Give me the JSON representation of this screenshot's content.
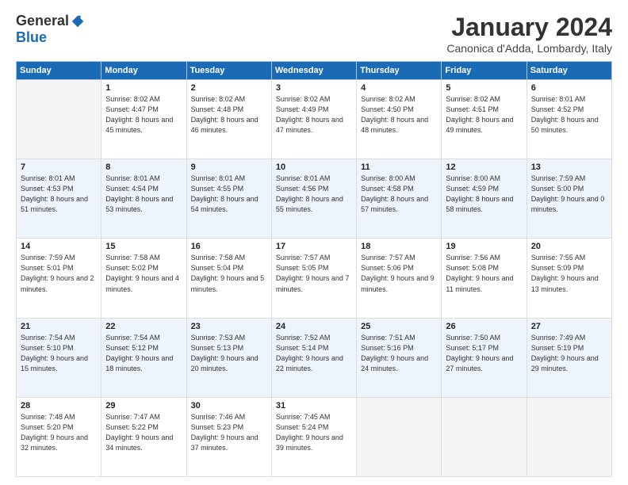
{
  "header": {
    "logo_general": "General",
    "logo_blue": "Blue",
    "month_title": "January 2024",
    "location": "Canonica d'Adda, Lombardy, Italy"
  },
  "weekdays": [
    "Sunday",
    "Monday",
    "Tuesday",
    "Wednesday",
    "Thursday",
    "Friday",
    "Saturday"
  ],
  "weeks": [
    [
      {
        "day": "",
        "sunrise": "",
        "sunset": "",
        "daylight": "",
        "empty": true
      },
      {
        "day": "1",
        "sunrise": "Sunrise: 8:02 AM",
        "sunset": "Sunset: 4:47 PM",
        "daylight": "Daylight: 8 hours and 45 minutes.",
        "empty": false
      },
      {
        "day": "2",
        "sunrise": "Sunrise: 8:02 AM",
        "sunset": "Sunset: 4:48 PM",
        "daylight": "Daylight: 8 hours and 46 minutes.",
        "empty": false
      },
      {
        "day": "3",
        "sunrise": "Sunrise: 8:02 AM",
        "sunset": "Sunset: 4:49 PM",
        "daylight": "Daylight: 8 hours and 47 minutes.",
        "empty": false
      },
      {
        "day": "4",
        "sunrise": "Sunrise: 8:02 AM",
        "sunset": "Sunset: 4:50 PM",
        "daylight": "Daylight: 8 hours and 48 minutes.",
        "empty": false
      },
      {
        "day": "5",
        "sunrise": "Sunrise: 8:02 AM",
        "sunset": "Sunset: 4:51 PM",
        "daylight": "Daylight: 8 hours and 49 minutes.",
        "empty": false
      },
      {
        "day": "6",
        "sunrise": "Sunrise: 8:01 AM",
        "sunset": "Sunset: 4:52 PM",
        "daylight": "Daylight: 8 hours and 50 minutes.",
        "empty": false
      }
    ],
    [
      {
        "day": "7",
        "sunrise": "Sunrise: 8:01 AM",
        "sunset": "Sunset: 4:53 PM",
        "daylight": "Daylight: 8 hours and 51 minutes.",
        "empty": false
      },
      {
        "day": "8",
        "sunrise": "Sunrise: 8:01 AM",
        "sunset": "Sunset: 4:54 PM",
        "daylight": "Daylight: 8 hours and 53 minutes.",
        "empty": false
      },
      {
        "day": "9",
        "sunrise": "Sunrise: 8:01 AM",
        "sunset": "Sunset: 4:55 PM",
        "daylight": "Daylight: 8 hours and 54 minutes.",
        "empty": false
      },
      {
        "day": "10",
        "sunrise": "Sunrise: 8:01 AM",
        "sunset": "Sunset: 4:56 PM",
        "daylight": "Daylight: 8 hours and 55 minutes.",
        "empty": false
      },
      {
        "day": "11",
        "sunrise": "Sunrise: 8:00 AM",
        "sunset": "Sunset: 4:58 PM",
        "daylight": "Daylight: 8 hours and 57 minutes.",
        "empty": false
      },
      {
        "day": "12",
        "sunrise": "Sunrise: 8:00 AM",
        "sunset": "Sunset: 4:59 PM",
        "daylight": "Daylight: 8 hours and 58 minutes.",
        "empty": false
      },
      {
        "day": "13",
        "sunrise": "Sunrise: 7:59 AM",
        "sunset": "Sunset: 5:00 PM",
        "daylight": "Daylight: 9 hours and 0 minutes.",
        "empty": false
      }
    ],
    [
      {
        "day": "14",
        "sunrise": "Sunrise: 7:59 AM",
        "sunset": "Sunset: 5:01 PM",
        "daylight": "Daylight: 9 hours and 2 minutes.",
        "empty": false
      },
      {
        "day": "15",
        "sunrise": "Sunrise: 7:58 AM",
        "sunset": "Sunset: 5:02 PM",
        "daylight": "Daylight: 9 hours and 4 minutes.",
        "empty": false
      },
      {
        "day": "16",
        "sunrise": "Sunrise: 7:58 AM",
        "sunset": "Sunset: 5:04 PM",
        "daylight": "Daylight: 9 hours and 5 minutes.",
        "empty": false
      },
      {
        "day": "17",
        "sunrise": "Sunrise: 7:57 AM",
        "sunset": "Sunset: 5:05 PM",
        "daylight": "Daylight: 9 hours and 7 minutes.",
        "empty": false
      },
      {
        "day": "18",
        "sunrise": "Sunrise: 7:57 AM",
        "sunset": "Sunset: 5:06 PM",
        "daylight": "Daylight: 9 hours and 9 minutes.",
        "empty": false
      },
      {
        "day": "19",
        "sunrise": "Sunrise: 7:56 AM",
        "sunset": "Sunset: 5:08 PM",
        "daylight": "Daylight: 9 hours and 11 minutes.",
        "empty": false
      },
      {
        "day": "20",
        "sunrise": "Sunrise: 7:55 AM",
        "sunset": "Sunset: 5:09 PM",
        "daylight": "Daylight: 9 hours and 13 minutes.",
        "empty": false
      }
    ],
    [
      {
        "day": "21",
        "sunrise": "Sunrise: 7:54 AM",
        "sunset": "Sunset: 5:10 PM",
        "daylight": "Daylight: 9 hours and 15 minutes.",
        "empty": false
      },
      {
        "day": "22",
        "sunrise": "Sunrise: 7:54 AM",
        "sunset": "Sunset: 5:12 PM",
        "daylight": "Daylight: 9 hours and 18 minutes.",
        "empty": false
      },
      {
        "day": "23",
        "sunrise": "Sunrise: 7:53 AM",
        "sunset": "Sunset: 5:13 PM",
        "daylight": "Daylight: 9 hours and 20 minutes.",
        "empty": false
      },
      {
        "day": "24",
        "sunrise": "Sunrise: 7:52 AM",
        "sunset": "Sunset: 5:14 PM",
        "daylight": "Daylight: 9 hours and 22 minutes.",
        "empty": false
      },
      {
        "day": "25",
        "sunrise": "Sunrise: 7:51 AM",
        "sunset": "Sunset: 5:16 PM",
        "daylight": "Daylight: 9 hours and 24 minutes.",
        "empty": false
      },
      {
        "day": "26",
        "sunrise": "Sunrise: 7:50 AM",
        "sunset": "Sunset: 5:17 PM",
        "daylight": "Daylight: 9 hours and 27 minutes.",
        "empty": false
      },
      {
        "day": "27",
        "sunrise": "Sunrise: 7:49 AM",
        "sunset": "Sunset: 5:19 PM",
        "daylight": "Daylight: 9 hours and 29 minutes.",
        "empty": false
      }
    ],
    [
      {
        "day": "28",
        "sunrise": "Sunrise: 7:48 AM",
        "sunset": "Sunset: 5:20 PM",
        "daylight": "Daylight: 9 hours and 32 minutes.",
        "empty": false
      },
      {
        "day": "29",
        "sunrise": "Sunrise: 7:47 AM",
        "sunset": "Sunset: 5:22 PM",
        "daylight": "Daylight: 9 hours and 34 minutes.",
        "empty": false
      },
      {
        "day": "30",
        "sunrise": "Sunrise: 7:46 AM",
        "sunset": "Sunset: 5:23 PM",
        "daylight": "Daylight: 9 hours and 37 minutes.",
        "empty": false
      },
      {
        "day": "31",
        "sunrise": "Sunrise: 7:45 AM",
        "sunset": "Sunset: 5:24 PM",
        "daylight": "Daylight: 9 hours and 39 minutes.",
        "empty": false
      },
      {
        "day": "",
        "sunrise": "",
        "sunset": "",
        "daylight": "",
        "empty": true
      },
      {
        "day": "",
        "sunrise": "",
        "sunset": "",
        "daylight": "",
        "empty": true
      },
      {
        "day": "",
        "sunrise": "",
        "sunset": "",
        "daylight": "",
        "empty": true
      }
    ]
  ]
}
